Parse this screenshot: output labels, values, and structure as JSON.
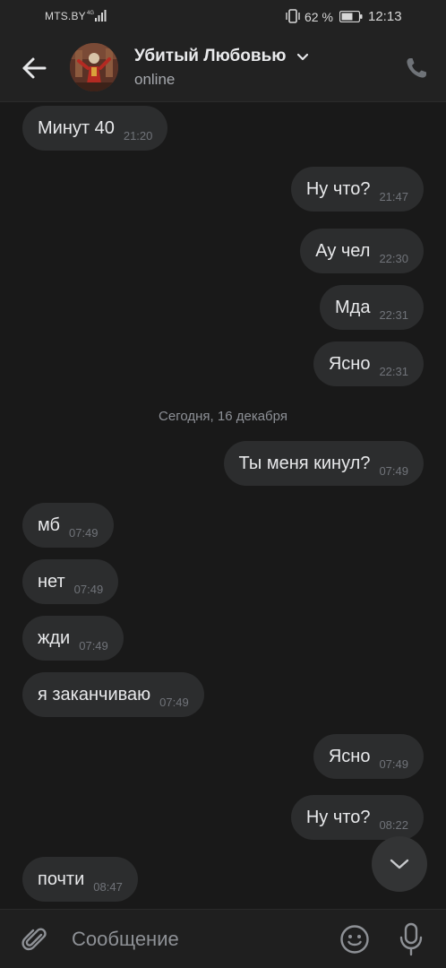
{
  "status_bar": {
    "carrier": "MTS.BY",
    "network": "4G",
    "battery": "62 %",
    "time": "12:13"
  },
  "header": {
    "contact_name": "Убитый Любовью",
    "status": "online"
  },
  "date_separator": "Сегодня, 16 декабря",
  "messages": [
    {
      "text": "Минут 40",
      "time": "21:20",
      "side": "incoming"
    },
    {
      "text": "Ну что?",
      "time": "21:47",
      "side": "outgoing"
    },
    {
      "text": "Ау чел",
      "time": "22:30",
      "side": "outgoing"
    },
    {
      "text": "Мда",
      "time": "22:31",
      "side": "outgoing"
    },
    {
      "text": "Ясно",
      "time": "22:31",
      "side": "outgoing"
    },
    {
      "text": "Ты меня кинул?",
      "time": "07:49",
      "side": "outgoing"
    },
    {
      "text": "мб",
      "time": "07:49",
      "side": "incoming"
    },
    {
      "text": "нет",
      "time": "07:49",
      "side": "incoming"
    },
    {
      "text": "жди",
      "time": "07:49",
      "side": "incoming"
    },
    {
      "text": "я заканчиваю",
      "time": "07:49",
      "side": "incoming"
    },
    {
      "text": "Ясно",
      "time": "07:49",
      "side": "outgoing"
    },
    {
      "text": "Ну что?",
      "time": "08:22",
      "side": "outgoing"
    },
    {
      "text": "почти",
      "time": "08:47",
      "side": "incoming"
    }
  ],
  "composer": {
    "placeholder": "Сообщение"
  },
  "colors": {
    "background": "#191919",
    "header": "#222222",
    "bubble": "#2c2d2e",
    "timestamp": "#707379"
  }
}
